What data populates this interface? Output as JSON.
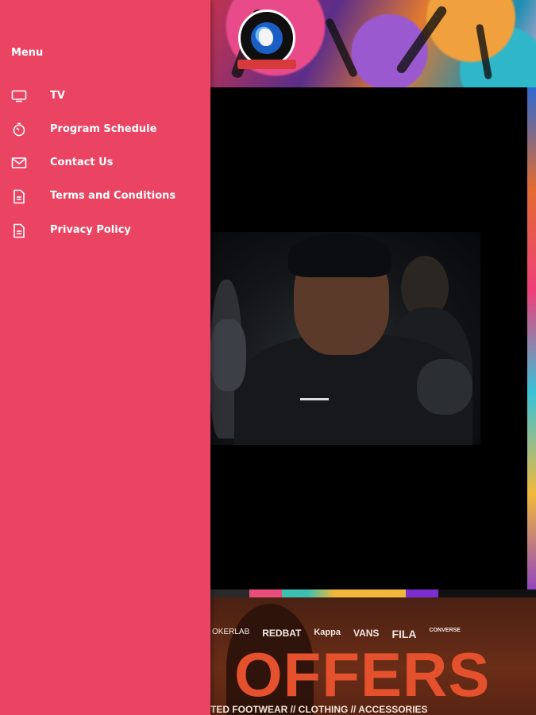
{
  "drawer": {
    "title": "Menu",
    "background": "#ea4462",
    "items": [
      {
        "label": "TV",
        "icon": "tv-icon"
      },
      {
        "label": "Program Schedule",
        "icon": "timer-icon"
      },
      {
        "label": "Contact Us",
        "icon": "mail-icon"
      },
      {
        "label": "Terms and Conditions",
        "icon": "document-icon"
      },
      {
        "label": "Privacy Policy",
        "icon": "document-icon"
      }
    ]
  },
  "promo": {
    "brands": [
      "OKERLAB",
      "REDBAT",
      "Kappa",
      "VANS",
      "FILA",
      "CONVERSE"
    ],
    "headline": "OFFERS",
    "tagline": "TED FOOTWEAR // CLOTHING // ACCESSORIES"
  }
}
